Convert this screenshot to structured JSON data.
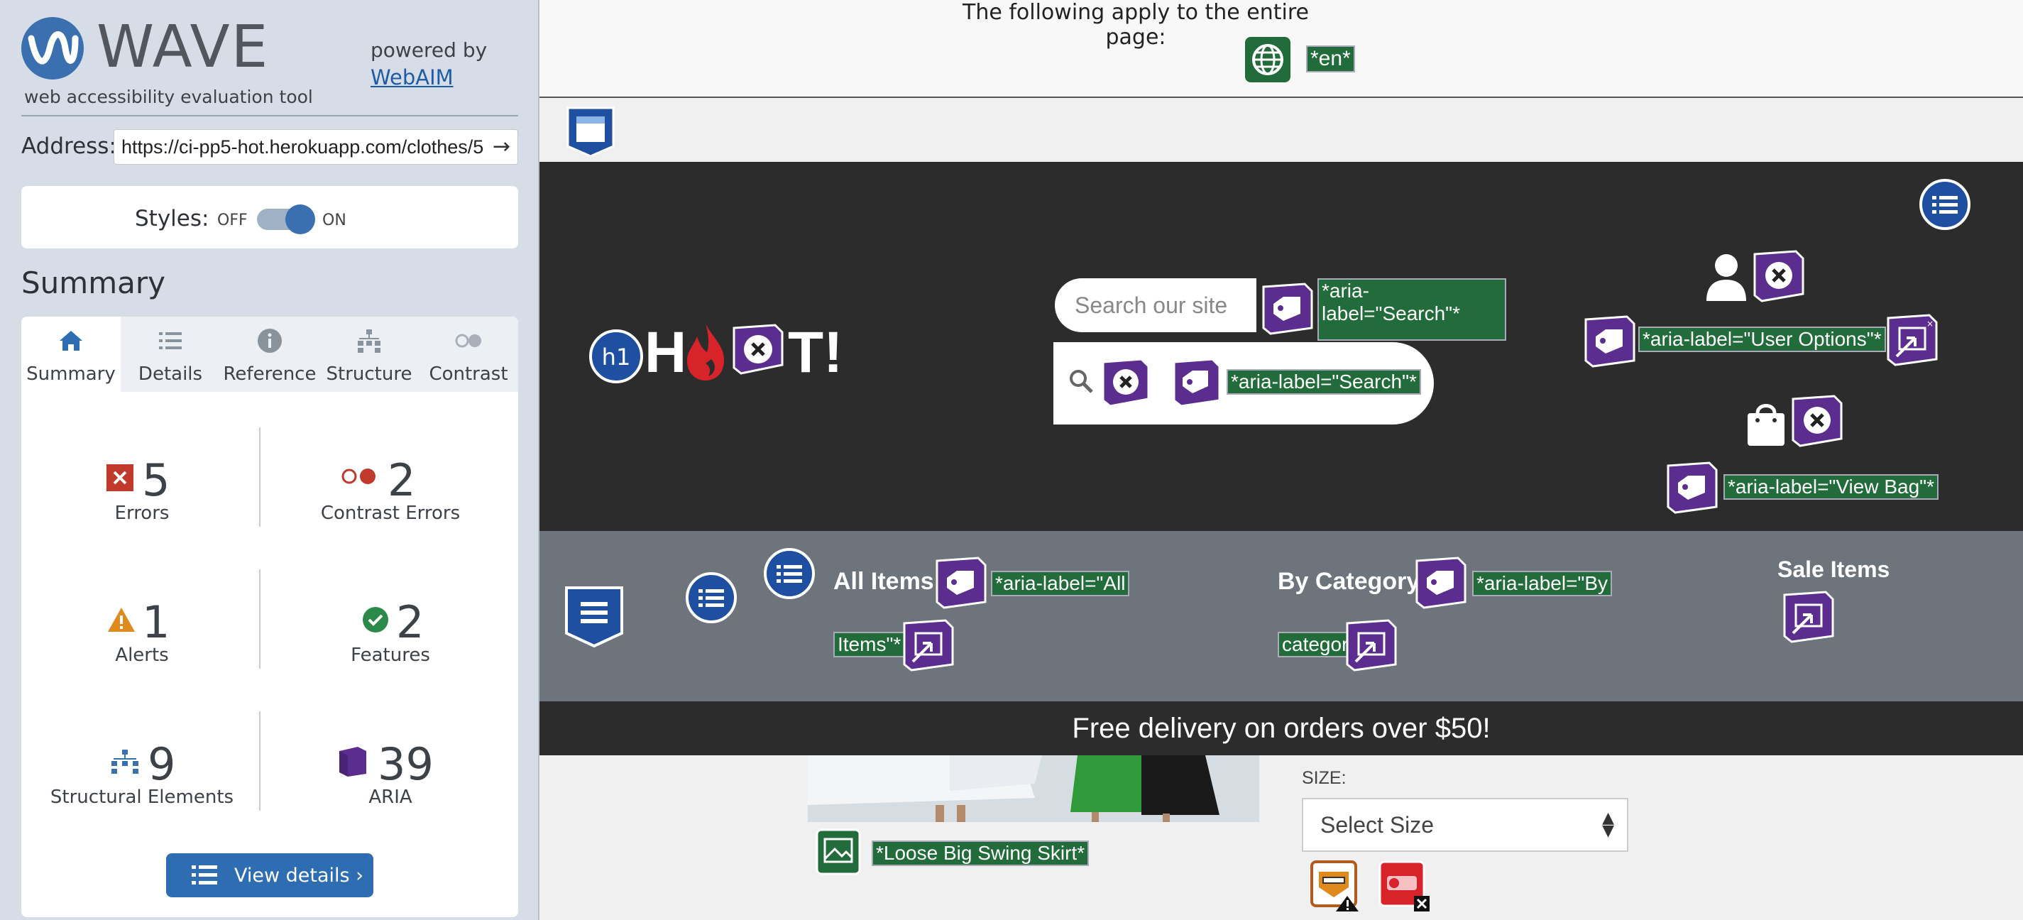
{
  "wave": {
    "title": "WAVE",
    "subtitle": "web accessibility evaluation tool",
    "powered_by": "powered by",
    "webaim_link": "WebAIM",
    "address_label": "Address:",
    "address_value": "https://ci-pp5-hot.herokuapp.com/clothes/5",
    "styles_label": "Styles:",
    "styles_off": "OFF",
    "styles_on": "ON",
    "styles_enabled": true,
    "summary_heading": "Summary",
    "tabs": [
      {
        "label": "Summary",
        "icon": "home-icon",
        "active": true
      },
      {
        "label": "Details",
        "icon": "list-icon",
        "active": false
      },
      {
        "label": "Reference",
        "icon": "info-icon",
        "active": false
      },
      {
        "label": "Structure",
        "icon": "structure-icon",
        "active": false
      },
      {
        "label": "Contrast",
        "icon": "contrast-icon",
        "active": false
      }
    ],
    "stats": {
      "errors": {
        "value": "5",
        "label": "Errors",
        "color": "#c0392b"
      },
      "contrast_errors": {
        "value": "2",
        "label": "Contrast Errors",
        "color": "#c0392b"
      },
      "alerts": {
        "value": "1",
        "label": "Alerts",
        "color": "#e08a1e"
      },
      "features": {
        "value": "2",
        "label": "Features",
        "color": "#2b8a4a"
      },
      "structural": {
        "value": "9",
        "label": "Structural Elements",
        "color": "#3a6fb0"
      },
      "aria": {
        "value": "39",
        "label": "ARIA",
        "color": "#5b2d8e"
      }
    },
    "view_details": "View details ›"
  },
  "page": {
    "whole_page_note": "The following apply to the entire page:",
    "lang_tag": "*en*",
    "logo": {
      "h1_badge": "h1",
      "letters_1": "H",
      "letters_2": "T!"
    },
    "search": {
      "placeholder": "Search our site",
      "aria_input": "*aria-label=\"Search\"*",
      "aria_button": "*aria-label=\"Search\"*"
    },
    "user_aria": "*aria-label=\"User Options\"*",
    "bag_aria": "*aria-label=\"View Bag\"*",
    "nav": {
      "all_items": "All Items",
      "all_items_aria_1": "*aria-label=\"All",
      "all_items_aria_2": "Items\"*",
      "by_category": "By Category",
      "by_category_aria_1": "*aria-label=\"By",
      "by_category_aria_2": "category\"*",
      "sale_items": "Sale Items"
    },
    "promo": "Free delivery on orders over $50!",
    "product_alt": "*Loose Big Swing Skirt*",
    "size_label": "SIZE:",
    "size_select": "Select Size",
    "colors": {
      "aria_purple": "#5b2d8e",
      "feature_green": "#226b3a",
      "structure_blue": "#1f4fa0",
      "error_red": "#d8232a"
    }
  }
}
